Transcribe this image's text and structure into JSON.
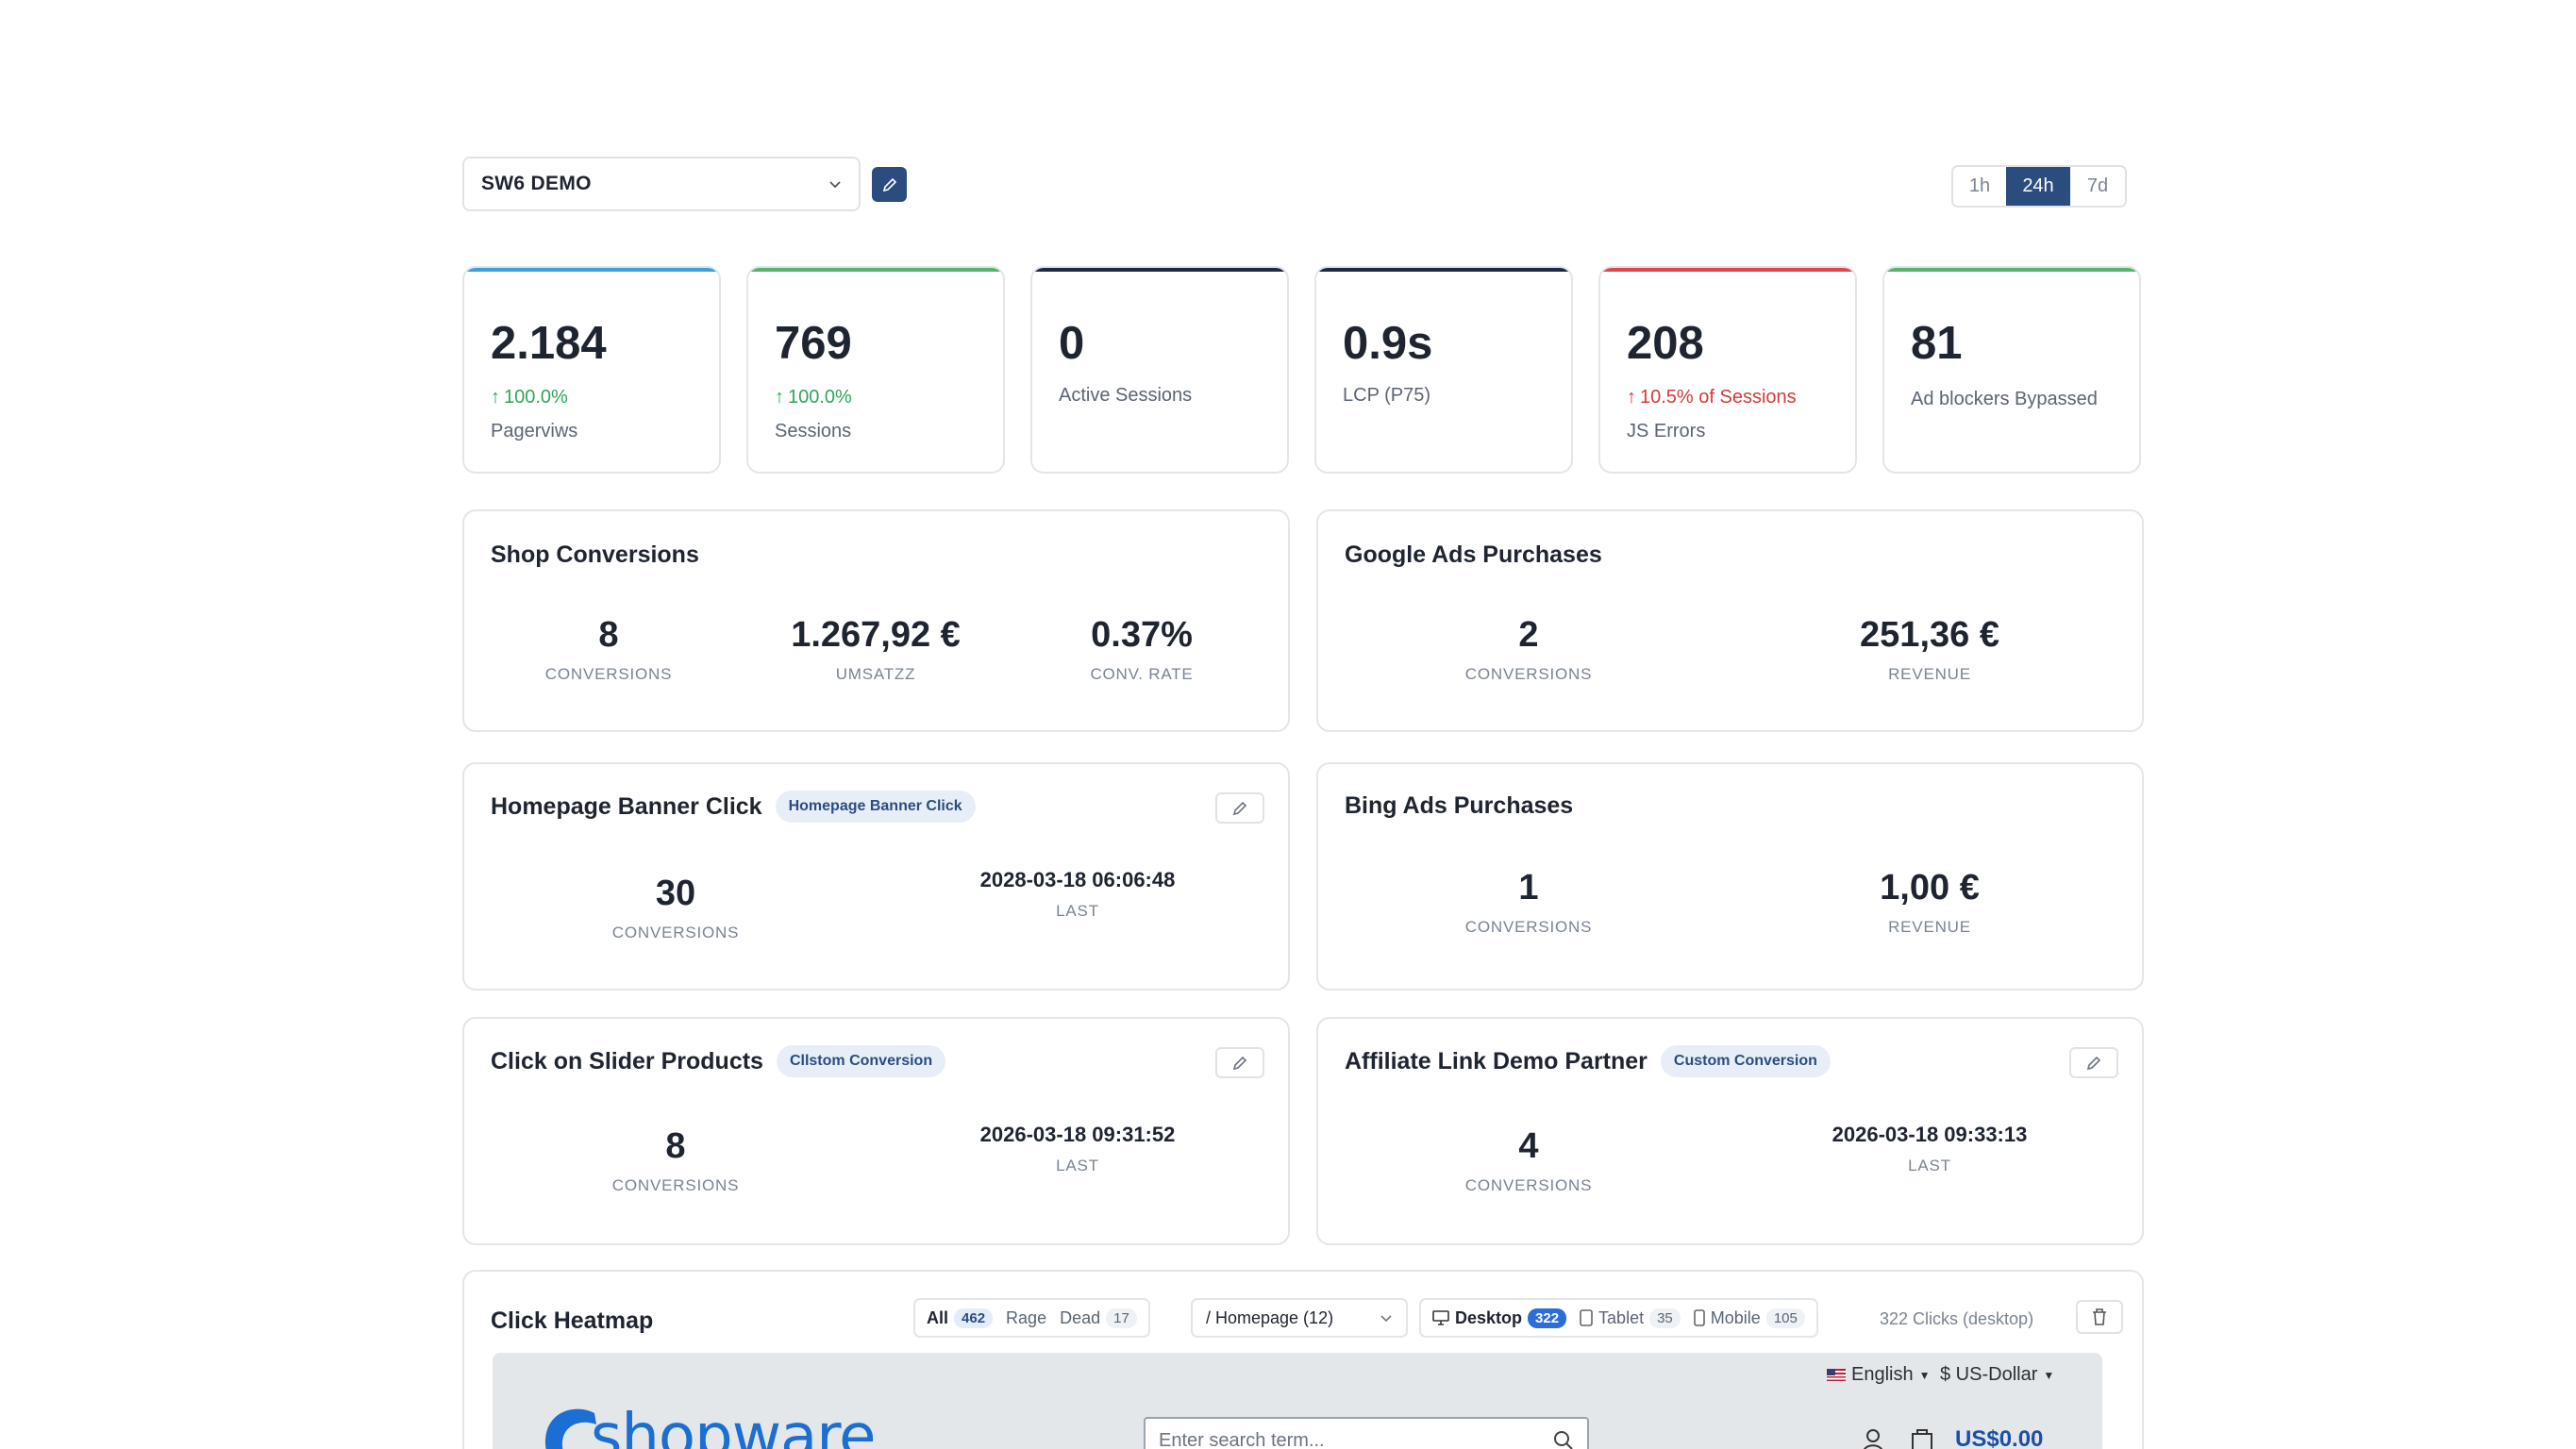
{
  "header": {
    "shop_name": "SW6 DEMO",
    "ranges": [
      "1h",
      "24h",
      "7d"
    ],
    "active_range": "24h"
  },
  "kpis": [
    {
      "value": "2.184",
      "delta": "100.0%",
      "label": "Pagerviws",
      "accent": "#3aa0d8"
    },
    {
      "value": "769",
      "delta": "100.0%",
      "label": "Sessions",
      "accent": "#56b36a"
    },
    {
      "value": "0",
      "label": "Active Sessions",
      "accent": "#1e2a44"
    },
    {
      "value": "0.9s",
      "label": "LCP (P75)",
      "accent": "#1e2a44"
    },
    {
      "value": "208",
      "delta": "10.5% of Sessions",
      "label": "JS Errors",
      "accent": "#e04646"
    },
    {
      "value": "81",
      "label": "Ad blockers Bypassed",
      "accent": "#56b36a"
    }
  ],
  "shop_conversions": {
    "title": "Shop Conversions",
    "conversions": "8",
    "conversions_label": "CONVERSIONS",
    "revenue": "1.267,92 €",
    "revenue_label": "UMSATZZ",
    "rate": "0.37%",
    "rate_label": "CONV. RATE"
  },
  "google_ads": {
    "title": "Google Ads Purchases",
    "conversions": "2",
    "conversions_label": "CONVERSIONS",
    "revenue": "251,36 €",
    "revenue_label": "REVENUE"
  },
  "homepage_banner": {
    "title": "Homepage Banner Click",
    "badge": "Homepage Banner Click",
    "conversions": "30",
    "conversions_label": "CONVERSIONS",
    "last": "2028-03-18 06:06:48",
    "last_label": "LAST"
  },
  "bing_ads": {
    "title": "Bing Ads Purchases",
    "conversions": "1",
    "conversions_label": "CONVERSIONS",
    "revenue": "1,00 €",
    "revenue_label": "REVENUE"
  },
  "slider_products": {
    "title": "Click on Slider Products",
    "badge": "Cllstom Conversion",
    "conversions": "8",
    "conversions_label": "CONVERSIONS",
    "last": "2026-03-18 09:31:52",
    "last_label": "LAST"
  },
  "affiliate": {
    "title": "Affiliate Link Demo Partner",
    "badge": "Custom Conversion",
    "conversions": "4",
    "conversions_label": "CONVERSIONS",
    "last": "2026-03-18 09:33:13",
    "last_label": "LAST"
  },
  "heatmap": {
    "title": "Click Heatmap",
    "filters": [
      {
        "label": "All",
        "count": "462"
      },
      {
        "label": "Rage"
      },
      {
        "label": "Dead",
        "count": "17"
      }
    ],
    "page": "/ Homepage (12)",
    "devices": [
      {
        "label": "Desktop",
        "count": "322"
      },
      {
        "label": "Tablet",
        "count": "35"
      },
      {
        "label": "Mobile",
        "count": "105"
      }
    ],
    "clicks_note": "322 Clicks (desktop)",
    "preview": {
      "language": "English",
      "currency": "$ US-Dollar",
      "logo": "shopware",
      "search_placeholder": "Enter search term...",
      "cart_total": "US$0.00"
    }
  }
}
